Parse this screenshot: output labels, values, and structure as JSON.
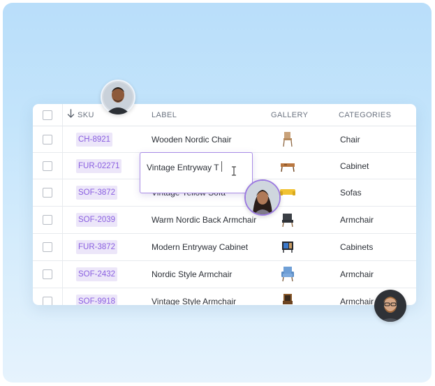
{
  "table": {
    "headers": {
      "sku": "SKU",
      "label": "LABEL",
      "gallery": "GALLERY",
      "categories": "CATEGORIES"
    },
    "rows": [
      {
        "sku": "CH-8921",
        "label": "Wooden Nordic Chair",
        "category": "Chair",
        "thumb": "wooden-chair-icon"
      },
      {
        "sku": "FUR-02271",
        "label": "",
        "category": "Cabinet",
        "thumb": "entryway-table-icon"
      },
      {
        "sku": "SOF-3872",
        "label": "Vintage Yellow Sofa",
        "category": "Sofas",
        "thumb": "yellow-sofa-icon"
      },
      {
        "sku": "SOF-2039",
        "label": "Warm Nordic Back Armchair",
        "category": "Armchair",
        "thumb": "armchair-icon"
      },
      {
        "sku": "FUR-3872",
        "label": "Modern Entryway Cabinet",
        "category": "Cabinets",
        "thumb": "cabinet-icon"
      },
      {
        "sku": "SOF-2432",
        "label": "Nordic Style Armchair",
        "category": "Armchair",
        "thumb": "blue-armchair-icon"
      },
      {
        "sku": "SOF-9918",
        "label": "Vintage Style Armchair",
        "category": "Armchair",
        "thumb": "vintage-armchair-icon"
      }
    ]
  },
  "editor": {
    "value": "Vintage Entryway T"
  },
  "colors": {
    "accent": "#8a5fe0",
    "chip_bg": "#ece6f9",
    "edit_border": "#a98ce6",
    "background_top": "#b9defa",
    "background_bottom": "#e6f3fd"
  }
}
